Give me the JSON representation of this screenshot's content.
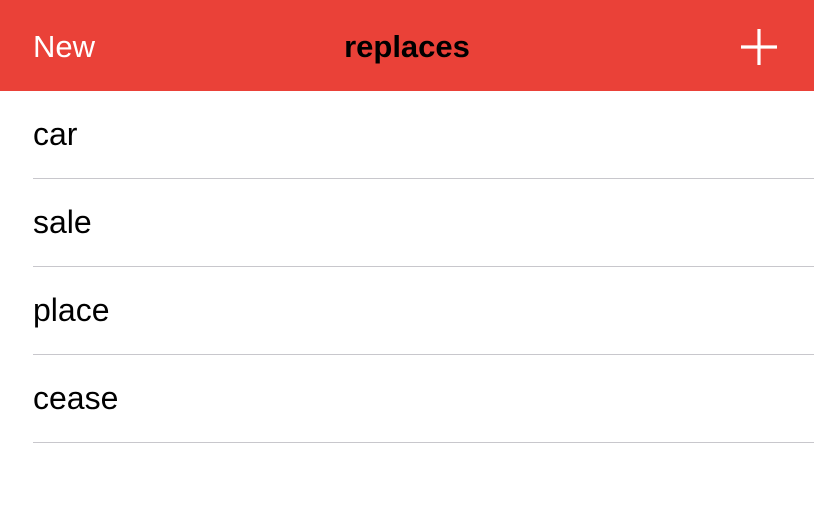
{
  "nav": {
    "left_label": "New",
    "title": "replaces",
    "add_icon": "plus-icon",
    "color": "#EA4138"
  },
  "list": {
    "items": [
      {
        "label": "car"
      },
      {
        "label": "sale"
      },
      {
        "label": "place"
      },
      {
        "label": "cease"
      }
    ]
  }
}
